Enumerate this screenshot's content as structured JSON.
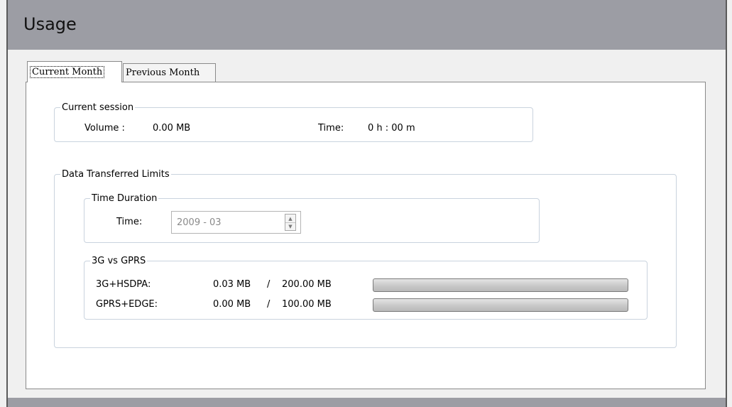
{
  "header": {
    "title": "Usage"
  },
  "tabs": [
    {
      "label": "Current Month",
      "active": true
    },
    {
      "label": "Previous Month",
      "active": false
    }
  ],
  "current_session": {
    "legend": "Current session",
    "volume_label": "Volume :",
    "volume_value": "0.00 MB",
    "time_label": "Time:",
    "time_value": "0 h : 00 m"
  },
  "limits": {
    "legend": "Data Transferred  Limits",
    "time_duration": {
      "legend": "Time Duration",
      "time_label": "Time:",
      "time_value": "2009 - 03"
    },
    "networks": {
      "legend": "3G vs GPRS",
      "rows": [
        {
          "label": "3G+HSDPA:",
          "used": "0.03 MB",
          "separator": "/",
          "limit": "200.00 MB",
          "fraction": 0.00015
        },
        {
          "label": "GPRS+EDGE:",
          "used": "0.00 MB",
          "separator": "/",
          "limit": "100.00 MB",
          "fraction": 0
        }
      ]
    }
  }
}
